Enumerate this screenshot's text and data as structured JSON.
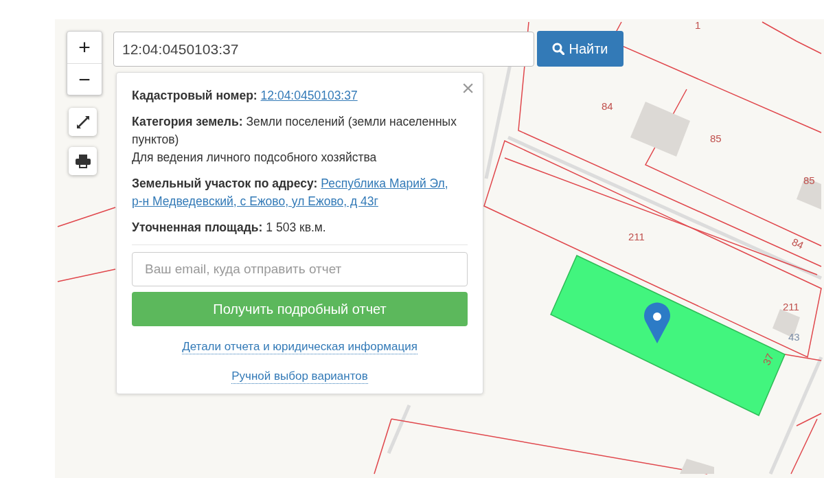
{
  "search": {
    "value": "12:04:0450103:37",
    "button": "Найти"
  },
  "zoom": {
    "in": "+",
    "out": "−"
  },
  "info": {
    "close": "×",
    "fields": [
      {
        "kind": "link",
        "label": "Кадастровый номер:",
        "value": "12:04:0450103:37"
      },
      {
        "kind": "text",
        "label": "Категория земель:",
        "value": "Земли поселений (земли населенных пунктов)",
        "note": "Для ведения личного подсобного хозяйства"
      },
      {
        "kind": "link",
        "label": "Земельный участок по адресу:",
        "value_lines": [
          "Республика Марий Эл,",
          "р-н Медведевский, с Ежово, ул Ежово, д 43г"
        ]
      },
      {
        "kind": "text",
        "label": "Уточненная площадь:",
        "value": "1 503 кв.м."
      }
    ],
    "email": {
      "placeholder": "Ваш email, куда отправить отчет"
    },
    "submit": "Получить подробный отчет",
    "links": [
      "Детали отчета и юридическая информация",
      "Ручной выбор вариантов"
    ]
  },
  "map": {
    "labels": [
      "1",
      "84",
      "85",
      "85",
      "211",
      "84",
      "211",
      "43",
      "37"
    ]
  }
}
